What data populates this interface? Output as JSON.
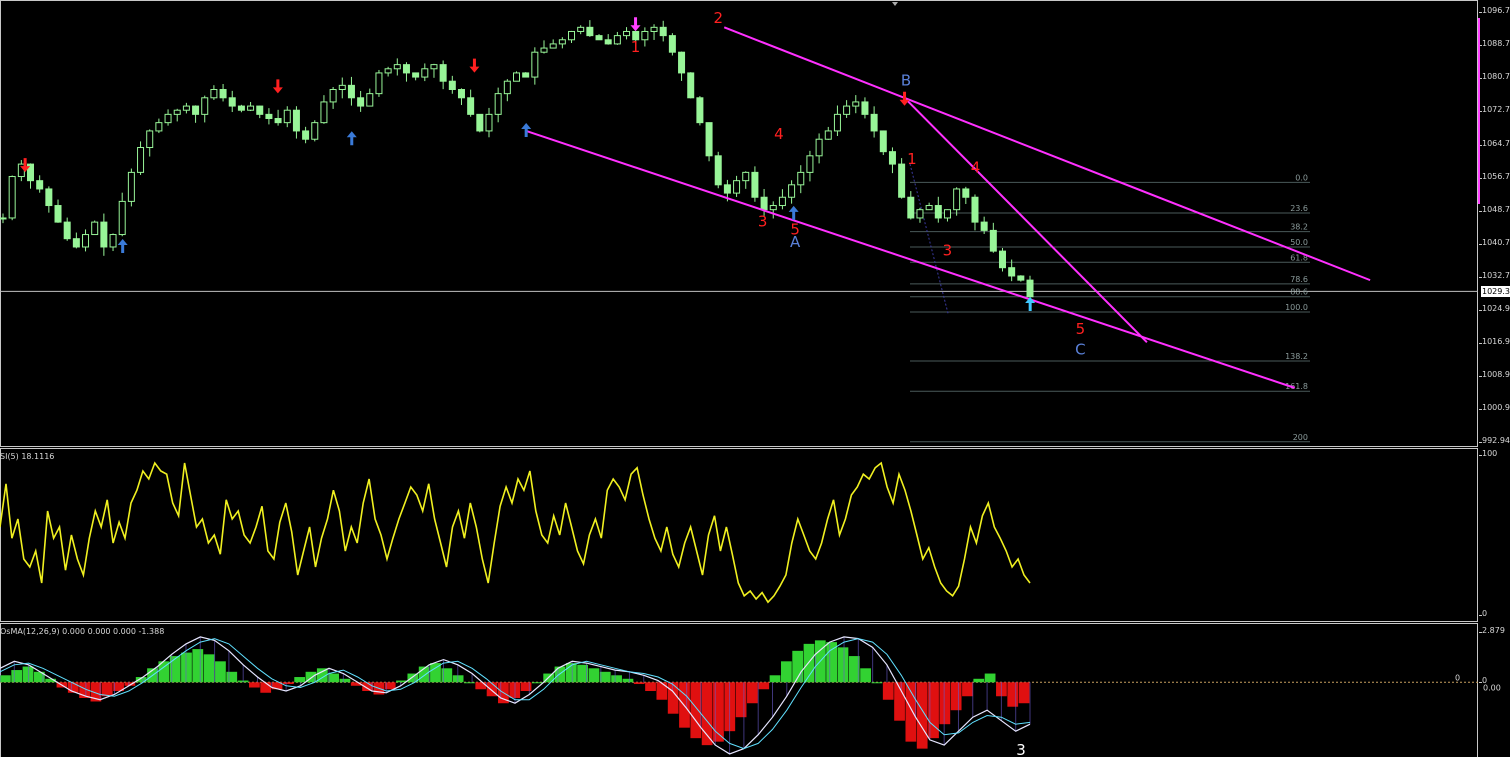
{
  "chart_data": [
    {
      "type": "candlestick",
      "pane": "main",
      "ylim": [
        992.94,
        1096.7
      ],
      "y_ticks": [
        "1096.7",
        "1088.7",
        "1080.7",
        "1072.7",
        "1064.7",
        "1056.7",
        "1048.7",
        "1040.7",
        "1032.7",
        "1024.9",
        "1016.9",
        "1008.9",
        "1000.9",
        "992.94"
      ],
      "current_price_label": "1029.3",
      "current_price": 1029.3,
      "candle_color": "#98f598",
      "close_path": [
        1047,
        1057,
        1060,
        1056,
        1054,
        1050,
        1046,
        1042,
        1040,
        1043,
        1046,
        1040,
        1043,
        1051,
        1058,
        1064,
        1068,
        1070,
        1072,
        1073,
        1074,
        1072,
        1076,
        1078,
        1076,
        1074,
        1073,
        1074,
        1072,
        1071,
        1070,
        1073,
        1068,
        1066,
        1070,
        1075,
        1078,
        1079,
        1076,
        1074,
        1077,
        1082,
        1083,
        1084,
        1082,
        1081,
        1083,
        1084,
        1080,
        1078,
        1076,
        1072,
        1068,
        1072,
        1077,
        1080,
        1082,
        1081,
        1087,
        1088,
        1089,
        1090,
        1092,
        1093,
        1091,
        1090,
        1089,
        1091,
        1092,
        1090,
        1092,
        1093,
        1091,
        1087,
        1082,
        1076,
        1070,
        1062,
        1055,
        1053,
        1056,
        1058,
        1052,
        1049,
        1050,
        1052,
        1055,
        1058,
        1062,
        1066,
        1068,
        1072,
        1074,
        1075,
        1072,
        1068,
        1063,
        1060,
        1052,
        1047,
        1049,
        1050,
        1047,
        1049,
        1054,
        1052,
        1046,
        1044,
        1039,
        1035,
        1033,
        1032,
        1028
      ],
      "arrows": [
        {
          "color": "#ff2020",
          "dir": "down",
          "t": 0.017,
          "v": 1060
        },
        {
          "color": "#3a7ad8",
          "dir": "up",
          "t": 0.083,
          "v": 1040
        },
        {
          "color": "#ff2020",
          "dir": "down",
          "t": 0.188,
          "v": 1079
        },
        {
          "color": "#3a7ad8",
          "dir": "up",
          "t": 0.238,
          "v": 1066
        },
        {
          "color": "#ff2020",
          "dir": "down",
          "t": 0.321,
          "v": 1084
        },
        {
          "color": "#3a7ad8",
          "dir": "up",
          "t": 0.356,
          "v": 1068
        },
        {
          "color": "#ff40ff",
          "dir": "down",
          "t": 0.43,
          "v": 1094
        },
        {
          "color": "#3a7ad8",
          "dir": "up",
          "t": 0.537,
          "v": 1048
        },
        {
          "color": "#ff2020",
          "dir": "down",
          "t": 0.612,
          "v": 1076
        },
        {
          "color": "#40c8ff",
          "dir": "up",
          "t": 0.697,
          "v": 1026
        }
      ],
      "wave_labels": [
        {
          "text": "1",
          "color": "#ff2020",
          "t": 0.43,
          "v": 1087
        },
        {
          "text": "2",
          "color": "#ff2020",
          "t": 0.486,
          "v": 1094
        },
        {
          "text": "3",
          "color": "#ff2020",
          "t": 0.516,
          "v": 1045
        },
        {
          "text": "4",
          "color": "#ff2020",
          "t": 0.527,
          "v": 1066
        },
        {
          "text": "5",
          "color": "#ff2020",
          "t": 0.538,
          "v": 1043
        },
        {
          "text": "A",
          "color": "#5a80d8",
          "t": 0.538,
          "v": 1040
        },
        {
          "text": "B",
          "color": "#5a80d8",
          "t": 0.613,
          "v": 1079
        },
        {
          "text": "1",
          "color": "#ff2020",
          "t": 0.617,
          "v": 1060
        },
        {
          "text": "3",
          "color": "#ff2020",
          "t": 0.641,
          "v": 1038
        },
        {
          "text": "4",
          "color": "#ff2020",
          "t": 0.66,
          "v": 1058
        },
        {
          "text": "5",
          "color": "#ff2020",
          "t": 0.731,
          "v": 1019
        },
        {
          "text": "C",
          "color": "#5a80d8",
          "t": 0.731,
          "v": 1014
        }
      ],
      "trendlines": [
        {
          "t1": 0.356,
          "v1": 1068,
          "t2": 0.876,
          "v2": 1006
        },
        {
          "t1": 0.49,
          "v1": 1093,
          "t2": 0.927,
          "v2": 1032
        },
        {
          "t1": 0.612,
          "v1": 1076,
          "t2": 0.776,
          "v2": 1017
        }
      ],
      "fibonacci": {
        "levels": [
          "0.0",
          "23.6",
          "38.2",
          "50.0",
          "61.8",
          "78.6",
          "88.6",
          "100.0",
          "138.2",
          "161.8",
          "200"
        ],
        "values": [
          1055.6,
          1048.2,
          1043.7,
          1040.0,
          1036.3,
          1031.1,
          1028.0,
          1024.3,
          1012.5,
          1005.2,
          993.0
        ]
      }
    },
    {
      "type": "line",
      "pane": "rsi",
      "indicator_label": "SI(5) 18.1116",
      "ylim": [
        0,
        100
      ],
      "y_ticks": [
        "100",
        "0"
      ],
      "line_color": "#f0f020",
      "series": [
        {
          "values": [
            55,
            82,
            48,
            60,
            35,
            30,
            40,
            20,
            65,
            48,
            55,
            28,
            50,
            35,
            25,
            48,
            65,
            55,
            72,
            45,
            58,
            48,
            70,
            78,
            90,
            85,
            95,
            90,
            88,
            70,
            62,
            95,
            75,
            55,
            60,
            45,
            50,
            38,
            72,
            60,
            65,
            50,
            45,
            55,
            68,
            40,
            35,
            58,
            70,
            52,
            25,
            40,
            55,
            30,
            48,
            60,
            78,
            65,
            40,
            55,
            45,
            70,
            85,
            60,
            50,
            35,
            48,
            60,
            70,
            80,
            75,
            65,
            82,
            60,
            45,
            30,
            55,
            65,
            48,
            70,
            55,
            35,
            20,
            45,
            68,
            80,
            70,
            85,
            78,
            90,
            65,
            50,
            45,
            62,
            50,
            70,
            55,
            40,
            32,
            50,
            60,
            48,
            78,
            85,
            80,
            72,
            88,
            92,
            75,
            60,
            48,
            40,
            55,
            38,
            30,
            45,
            55,
            40,
            25,
            50,
            62,
            40,
            55,
            38,
            20,
            12,
            15,
            10,
            14,
            8,
            12,
            18,
            25,
            45,
            60,
            50,
            40,
            35,
            45,
            60,
            72,
            50,
            60,
            75,
            80,
            88,
            85,
            92,
            95,
            80,
            70,
            88,
            78,
            65,
            50,
            35,
            42,
            30,
            20,
            15,
            12,
            18,
            35,
            55,
            45,
            62,
            70,
            55,
            48,
            40,
            30,
            35,
            25,
            20
          ]
        }
      ]
    },
    {
      "type": "bar",
      "pane": "osma",
      "indicator_label": "OsMA(12,26,9) 0.000 0.000 0.000 -1.388",
      "ylim": [
        -4.279,
        2.879
      ],
      "y_ticks": [
        "2.879",
        "0",
        "0.00",
        "-4.279"
      ],
      "zero_line_label": "0",
      "positive_color": "#32d232",
      "negative_color": "#e01010",
      "macd_color": "#e6e6ff",
      "signal_color": "#60e0ff",
      "wave_label": "3",
      "series": [
        {
          "name": "histogram",
          "values": [
            0.4,
            0.7,
            0.9,
            0.6,
            0.2,
            -0.3,
            -0.6,
            -0.9,
            -1.1,
            -0.8,
            -0.5,
            -0.2,
            0.3,
            0.8,
            1.2,
            1.5,
            1.7,
            1.9,
            1.6,
            1.2,
            0.6,
            0.1,
            -0.3,
            -0.6,
            -0.4,
            -0.1,
            0.3,
            0.6,
            0.8,
            0.5,
            0.2,
            -0.2,
            -0.5,
            -0.7,
            -0.4,
            0.1,
            0.5,
            0.9,
            1.1,
            0.8,
            0.4,
            0.0,
            -0.4,
            -0.8,
            -1.2,
            -0.9,
            -0.5,
            0.0,
            0.5,
            0.9,
            1.1,
            1.0,
            0.8,
            0.6,
            0.4,
            0.2,
            -0.1,
            -0.5,
            -1.0,
            -1.8,
            -2.6,
            -3.2,
            -3.6,
            -3.4,
            -2.8,
            -2.0,
            -1.2,
            -0.4,
            0.4,
            1.2,
            1.8,
            2.2,
            2.4,
            2.3,
            2.0,
            1.5,
            0.8,
            0.0,
            -1.0,
            -2.2,
            -3.4,
            -3.8,
            -3.2,
            -2.4,
            -1.6,
            -0.8,
            0.2,
            0.5,
            -0.8,
            -1.4,
            -1.2
          ]
        },
        {
          "name": "macd",
          "values": [
            0.8,
            1.2,
            1.0,
            0.5,
            0.0,
            -0.5,
            -0.8,
            -1.0,
            -0.7,
            -0.2,
            0.3,
            0.9,
            1.6,
            2.2,
            2.6,
            2.4,
            1.8,
            1.0,
            0.3,
            -0.3,
            -0.5,
            -0.2,
            0.4,
            0.8,
            0.5,
            0.0,
            -0.5,
            -0.6,
            -0.2,
            0.4,
            1.0,
            1.3,
            1.0,
            0.5,
            -0.2,
            -0.9,
            -1.2,
            -0.7,
            0.0,
            0.8,
            1.2,
            1.1,
            0.9,
            0.7,
            0.6,
            0.4,
            0.1,
            -0.5,
            -1.5,
            -2.6,
            -3.6,
            -4.1,
            -3.8,
            -3.0,
            -2.0,
            -0.8,
            0.6,
            1.6,
            2.3,
            2.6,
            2.5,
            2.0,
            1.0,
            -0.5,
            -2.0,
            -3.3,
            -3.6,
            -2.8,
            -2.0,
            -1.6,
            -2.2,
            -2.8,
            -2.4
          ]
        },
        {
          "name": "signal",
          "values": [
            0.6,
            1.0,
            1.1,
            0.8,
            0.4,
            0.0,
            -0.4,
            -0.7,
            -0.8,
            -0.5,
            0.0,
            0.6,
            1.2,
            1.8,
            2.3,
            2.5,
            2.2,
            1.5,
            0.8,
            0.2,
            -0.2,
            -0.3,
            0.0,
            0.5,
            0.7,
            0.3,
            -0.2,
            -0.5,
            -0.4,
            0.0,
            0.6,
            1.1,
            1.2,
            0.8,
            0.2,
            -0.5,
            -1.0,
            -1.0,
            -0.4,
            0.4,
            1.0,
            1.2,
            1.0,
            0.8,
            0.6,
            0.5,
            0.3,
            -0.1,
            -0.8,
            -1.8,
            -2.8,
            -3.5,
            -3.8,
            -3.5,
            -2.7,
            -1.6,
            -0.3,
            0.9,
            1.8,
            2.3,
            2.5,
            2.3,
            1.6,
            0.4,
            -1.0,
            -2.3,
            -3.0,
            -2.9,
            -2.3,
            -1.9,
            -2.0,
            -2.4,
            -2.3
          ]
        }
      ]
    }
  ]
}
